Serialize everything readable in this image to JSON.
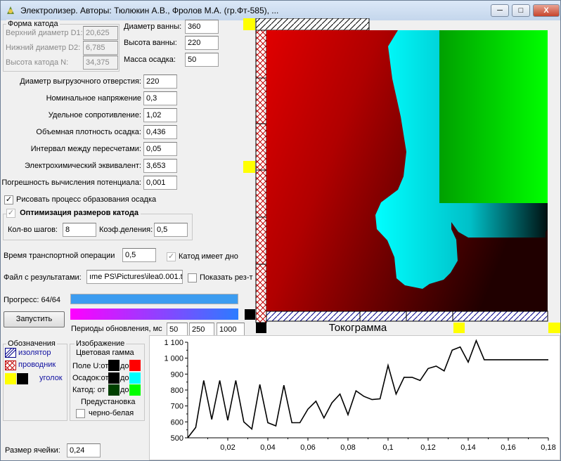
{
  "window": {
    "title": "Электролизер. Авторы: Тюлюкин А.В., Фролов М.А. (гр.Фт-585), ...",
    "min": "─",
    "max": "□",
    "close": "X"
  },
  "cathode_shape": {
    "title": "Форма катода",
    "d1_label": "Верхний диаметр D1:",
    "d1_value": "20,625",
    "d2_label": "Нижний диаметр D2:",
    "d2_value": "6,785",
    "h_label": "Высота катода N:",
    "h_value": "34,375"
  },
  "bath": {
    "diam_label": "Диаметр ванны:",
    "diam_value": "360",
    "height_label": "Высота ванны:",
    "height_value": "220",
    "mass_label": "Масса осадка:",
    "mass_value": "50"
  },
  "params": [
    {
      "label": "Диаметр выгрузочного отверстия:",
      "value": "220"
    },
    {
      "label": "Номинальное напряжение",
      "value": "0,3"
    },
    {
      "label": "Удельное сопротивление:",
      "value": "1,02"
    },
    {
      "label": "Объемная плотность осадка:",
      "value": "0,436"
    },
    {
      "label": "Интервал между пересчетами:",
      "value": "0,05"
    },
    {
      "label": "Электрохимический эквивалент:",
      "value": "3,653"
    },
    {
      "label": "Погрешность вычисления потенциала:",
      "value": "0,001"
    }
  ],
  "draw_process": {
    "label": "Рисовать процесс образования осадка",
    "check": "✓"
  },
  "optimize": {
    "title": "Оптимизация размеров катода",
    "check": "✓",
    "steps_label": "Кол-во шагов:",
    "steps_value": "8",
    "coef_label": "Коэф.деления:",
    "coef_value": "0,5"
  },
  "transport": {
    "label": "Время транспортной операции",
    "value": "0,5",
    "bottom_label": "Катод имеет дно",
    "check": "✓"
  },
  "results": {
    "label": "Файл с результатами:",
    "value": "ıme PS\\Pictures\\ilea0.001.t:",
    "show_label": "Показать рез-т"
  },
  "progress": {
    "label": "Прогресс: 64/64",
    "fraction": 1.0,
    "color": "#3c9cf0"
  },
  "run_button": "Запустить",
  "update": {
    "label": "Периоды обновления, мс",
    "v1": "50",
    "v2": "250",
    "v3": "1000"
  },
  "legend": {
    "title": "Обозначения",
    "insulator": "изолятор",
    "conductor": "проводник",
    "corner": "уголок"
  },
  "image_group": {
    "title": "Изображение",
    "gamma": "Цветовая гамма",
    "field_label": "Поле U:от",
    "to": "до",
    "deposit_label": "Осадок:от",
    "cathode_label": "Катод:  от",
    "preset": "Предустановка",
    "bw_label": "черно-белая",
    "colors": {
      "field_from": "#000000",
      "field_to": "#ff0000",
      "dep_from": "#000000",
      "dep_to": "#00ffff",
      "cat_from": "#004000",
      "cat_to": "#00ff00"
    }
  },
  "cell_size": {
    "label": "Размер ячейки:",
    "value": "0,24"
  },
  "chart_data": {
    "type": "line",
    "title": "Токограмма",
    "x": [
      0,
      0.004,
      0.008,
      0.012,
      0.016,
      0.02,
      0.024,
      0.028,
      0.032,
      0.036,
      0.04,
      0.044,
      0.048,
      0.052,
      0.056,
      0.06,
      0.064,
      0.068,
      0.072,
      0.076,
      0.08,
      0.084,
      0.088,
      0.092,
      0.096,
      0.1,
      0.104,
      0.108,
      0.112,
      0.116,
      0.12,
      0.124,
      0.128,
      0.132,
      0.136,
      0.14,
      0.144,
      0.148,
      0.152,
      0.156,
      0.16,
      0.164,
      0.168,
      0.172,
      0.176,
      0.18
    ],
    "y": [
      500,
      565,
      860,
      615,
      860,
      610,
      860,
      600,
      555,
      835,
      595,
      575,
      830,
      595,
      595,
      680,
      730,
      625,
      720,
      775,
      645,
      795,
      760,
      740,
      745,
      955,
      775,
      880,
      880,
      860,
      935,
      950,
      920,
      1050,
      1070,
      975,
      1110,
      990,
      990,
      990,
      990,
      990,
      990,
      990,
      990,
      990
    ],
    "xlim": [
      0,
      0.18
    ],
    "ylim": [
      500,
      1100
    ],
    "xticks": [
      "0,02",
      "0,04",
      "0,06",
      "0,08",
      "0,1",
      "0,12",
      "0,14",
      "0,16",
      "0,18"
    ],
    "yticks": [
      "1 100",
      "1 000",
      "900",
      "800",
      "700",
      "600",
      "500"
    ]
  }
}
